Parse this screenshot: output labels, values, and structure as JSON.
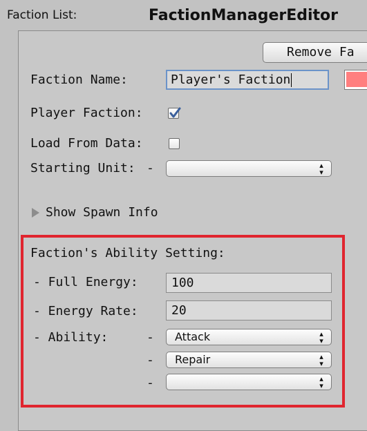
{
  "header": {
    "label": "Faction List:",
    "title": "FactionManagerEditor"
  },
  "remove_button": {
    "label": "Remove Fa"
  },
  "faction_name": {
    "label": "Faction Name:",
    "value": "Player's Faction",
    "color_swatch": "#ff7f7f"
  },
  "player_faction": {
    "label": "Player Faction:",
    "checked": true
  },
  "load_from_data": {
    "label": "Load From Data:",
    "checked": false
  },
  "starting_unit": {
    "label": "Starting Unit:",
    "dash": "-",
    "selected": ""
  },
  "spawn_info": {
    "label": "Show Spawn Info",
    "icon": "foldout-collapsed-icon"
  },
  "ability_settings": {
    "heading": "Faction's Ability Setting:",
    "full_energy": {
      "label": "- Full Energy:",
      "value": "100"
    },
    "energy_rate": {
      "label": "- Energy Rate:",
      "value": "20"
    },
    "ability": {
      "label": "- Ability:",
      "slots": [
        {
          "dash": "-",
          "selected": "Attack"
        },
        {
          "dash": "-",
          "selected": "Repair"
        },
        {
          "dash": "-",
          "selected": ""
        }
      ]
    },
    "highlight_color": "#e0252f"
  }
}
